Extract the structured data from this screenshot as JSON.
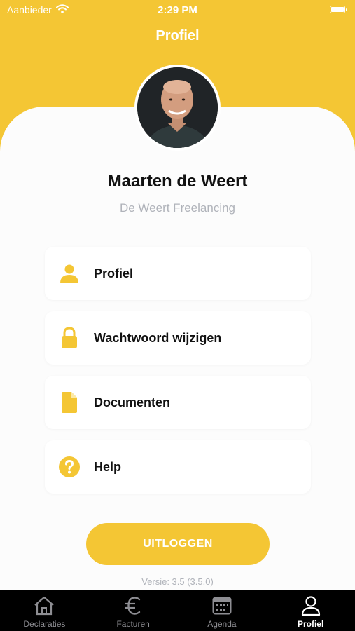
{
  "status_bar": {
    "carrier": "Aanbieder",
    "time": "2:29 PM"
  },
  "header": {
    "title": "Profiel"
  },
  "user": {
    "name": "Maarten de Weert",
    "company": "De Weert Freelancing"
  },
  "menu": [
    {
      "label": "Profiel",
      "icon": "person-icon"
    },
    {
      "label": "Wachtwoord wijzigen",
      "icon": "lock-icon"
    },
    {
      "label": "Documenten",
      "icon": "document-icon"
    },
    {
      "label": "Help",
      "icon": "help-icon"
    }
  ],
  "logout_label": "UITLOGGEN",
  "version": "Versie: 3.5 (3.5.0)",
  "tabs": [
    {
      "label": "Declaraties",
      "icon": "home-icon",
      "active": false
    },
    {
      "label": "Facturen",
      "icon": "euro-icon",
      "active": false
    },
    {
      "label": "Agenda",
      "icon": "calendar-icon",
      "active": false
    },
    {
      "label": "Profiel",
      "icon": "person-icon",
      "active": true
    }
  ],
  "colors": {
    "accent": "#f4c634",
    "background": "#fcfcfc",
    "tabbar": "#000000",
    "muted": "#b0b3ba"
  }
}
